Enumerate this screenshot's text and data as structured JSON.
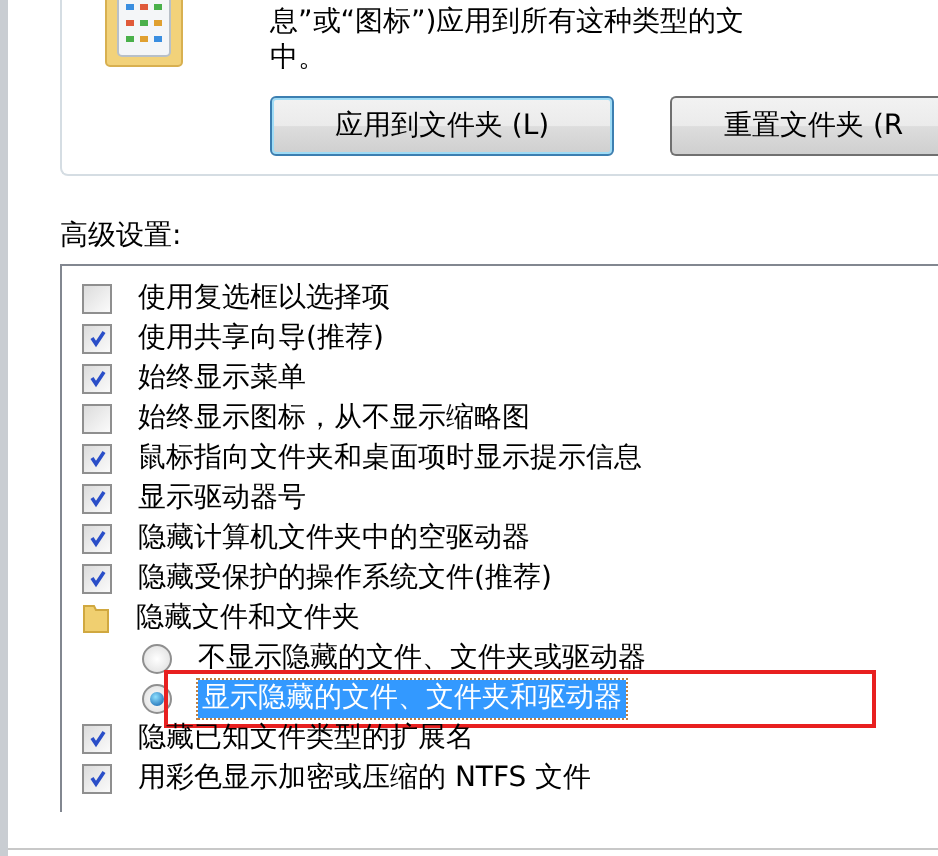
{
  "folder_views": {
    "description_lines": [
      "息”或“图标”)应用到所有这种类型的文",
      "中。"
    ],
    "buttons": [
      {
        "label": "应用到文件夹 (L)",
        "default": true
      },
      {
        "label": "重置文件夹 (R",
        "default": false
      }
    ]
  },
  "advanced_settings": {
    "label": "高级设置:",
    "items": [
      {
        "kind": "checkbox",
        "label": "使用复选框以选择项",
        "checked": false
      },
      {
        "kind": "checkbox",
        "label": "使用共享向导(推荐)",
        "checked": true
      },
      {
        "kind": "checkbox",
        "label": "始终显示菜单",
        "checked": true
      },
      {
        "kind": "checkbox",
        "label": "始终显示图标，从不显示缩略图",
        "checked": false
      },
      {
        "kind": "checkbox",
        "label": "鼠标指向文件夹和桌面项时显示提示信息",
        "checked": true
      },
      {
        "kind": "checkbox",
        "label": "显示驱动器号",
        "checked": true
      },
      {
        "kind": "checkbox",
        "label": "隐藏计算机文件夹中的空驱动器",
        "checked": true
      },
      {
        "kind": "checkbox",
        "label": "隐藏受保护的操作系统文件(推荐)",
        "checked": true
      },
      {
        "kind": "folder",
        "label": "隐藏文件和文件夹",
        "children": [
          {
            "kind": "radio",
            "label": "不显示隐藏的文件、文件夹或驱动器",
            "selected": false,
            "annotated": false
          },
          {
            "kind": "radio",
            "label": "显示隐藏的文件、文件夹和驱动器",
            "selected": true,
            "annotated": true
          }
        ]
      },
      {
        "kind": "checkbox",
        "label": "隐藏已知文件类型的扩展名",
        "checked": true
      },
      {
        "kind": "checkbox",
        "label": "用彩色显示加密或压缩的 NTFS 文件",
        "checked": true
      }
    ]
  }
}
